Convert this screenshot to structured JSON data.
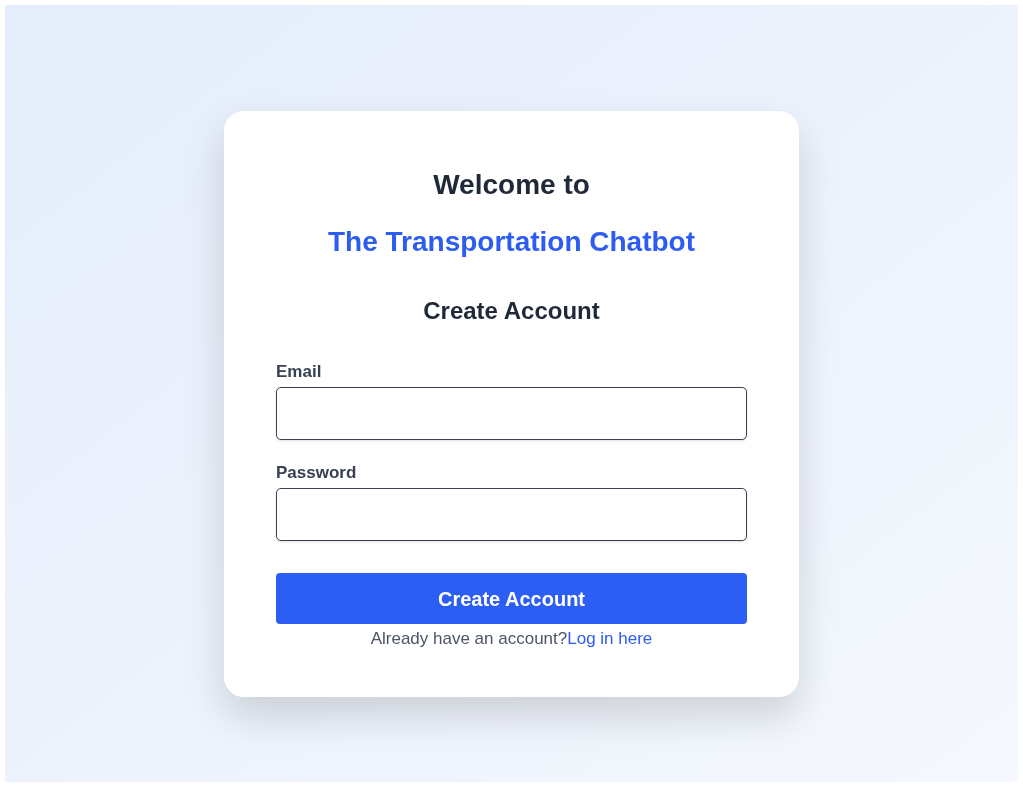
{
  "card": {
    "greeting": "Welcome to",
    "app_name": "The Transportation Chatbot",
    "heading": "Create Account",
    "fields": [
      {
        "label": "Email"
      },
      {
        "label": "Password"
      }
    ],
    "submit_button": "Create Account",
    "footer": {
      "text": "Already have an account?",
      "link": "Log in here"
    }
  }
}
